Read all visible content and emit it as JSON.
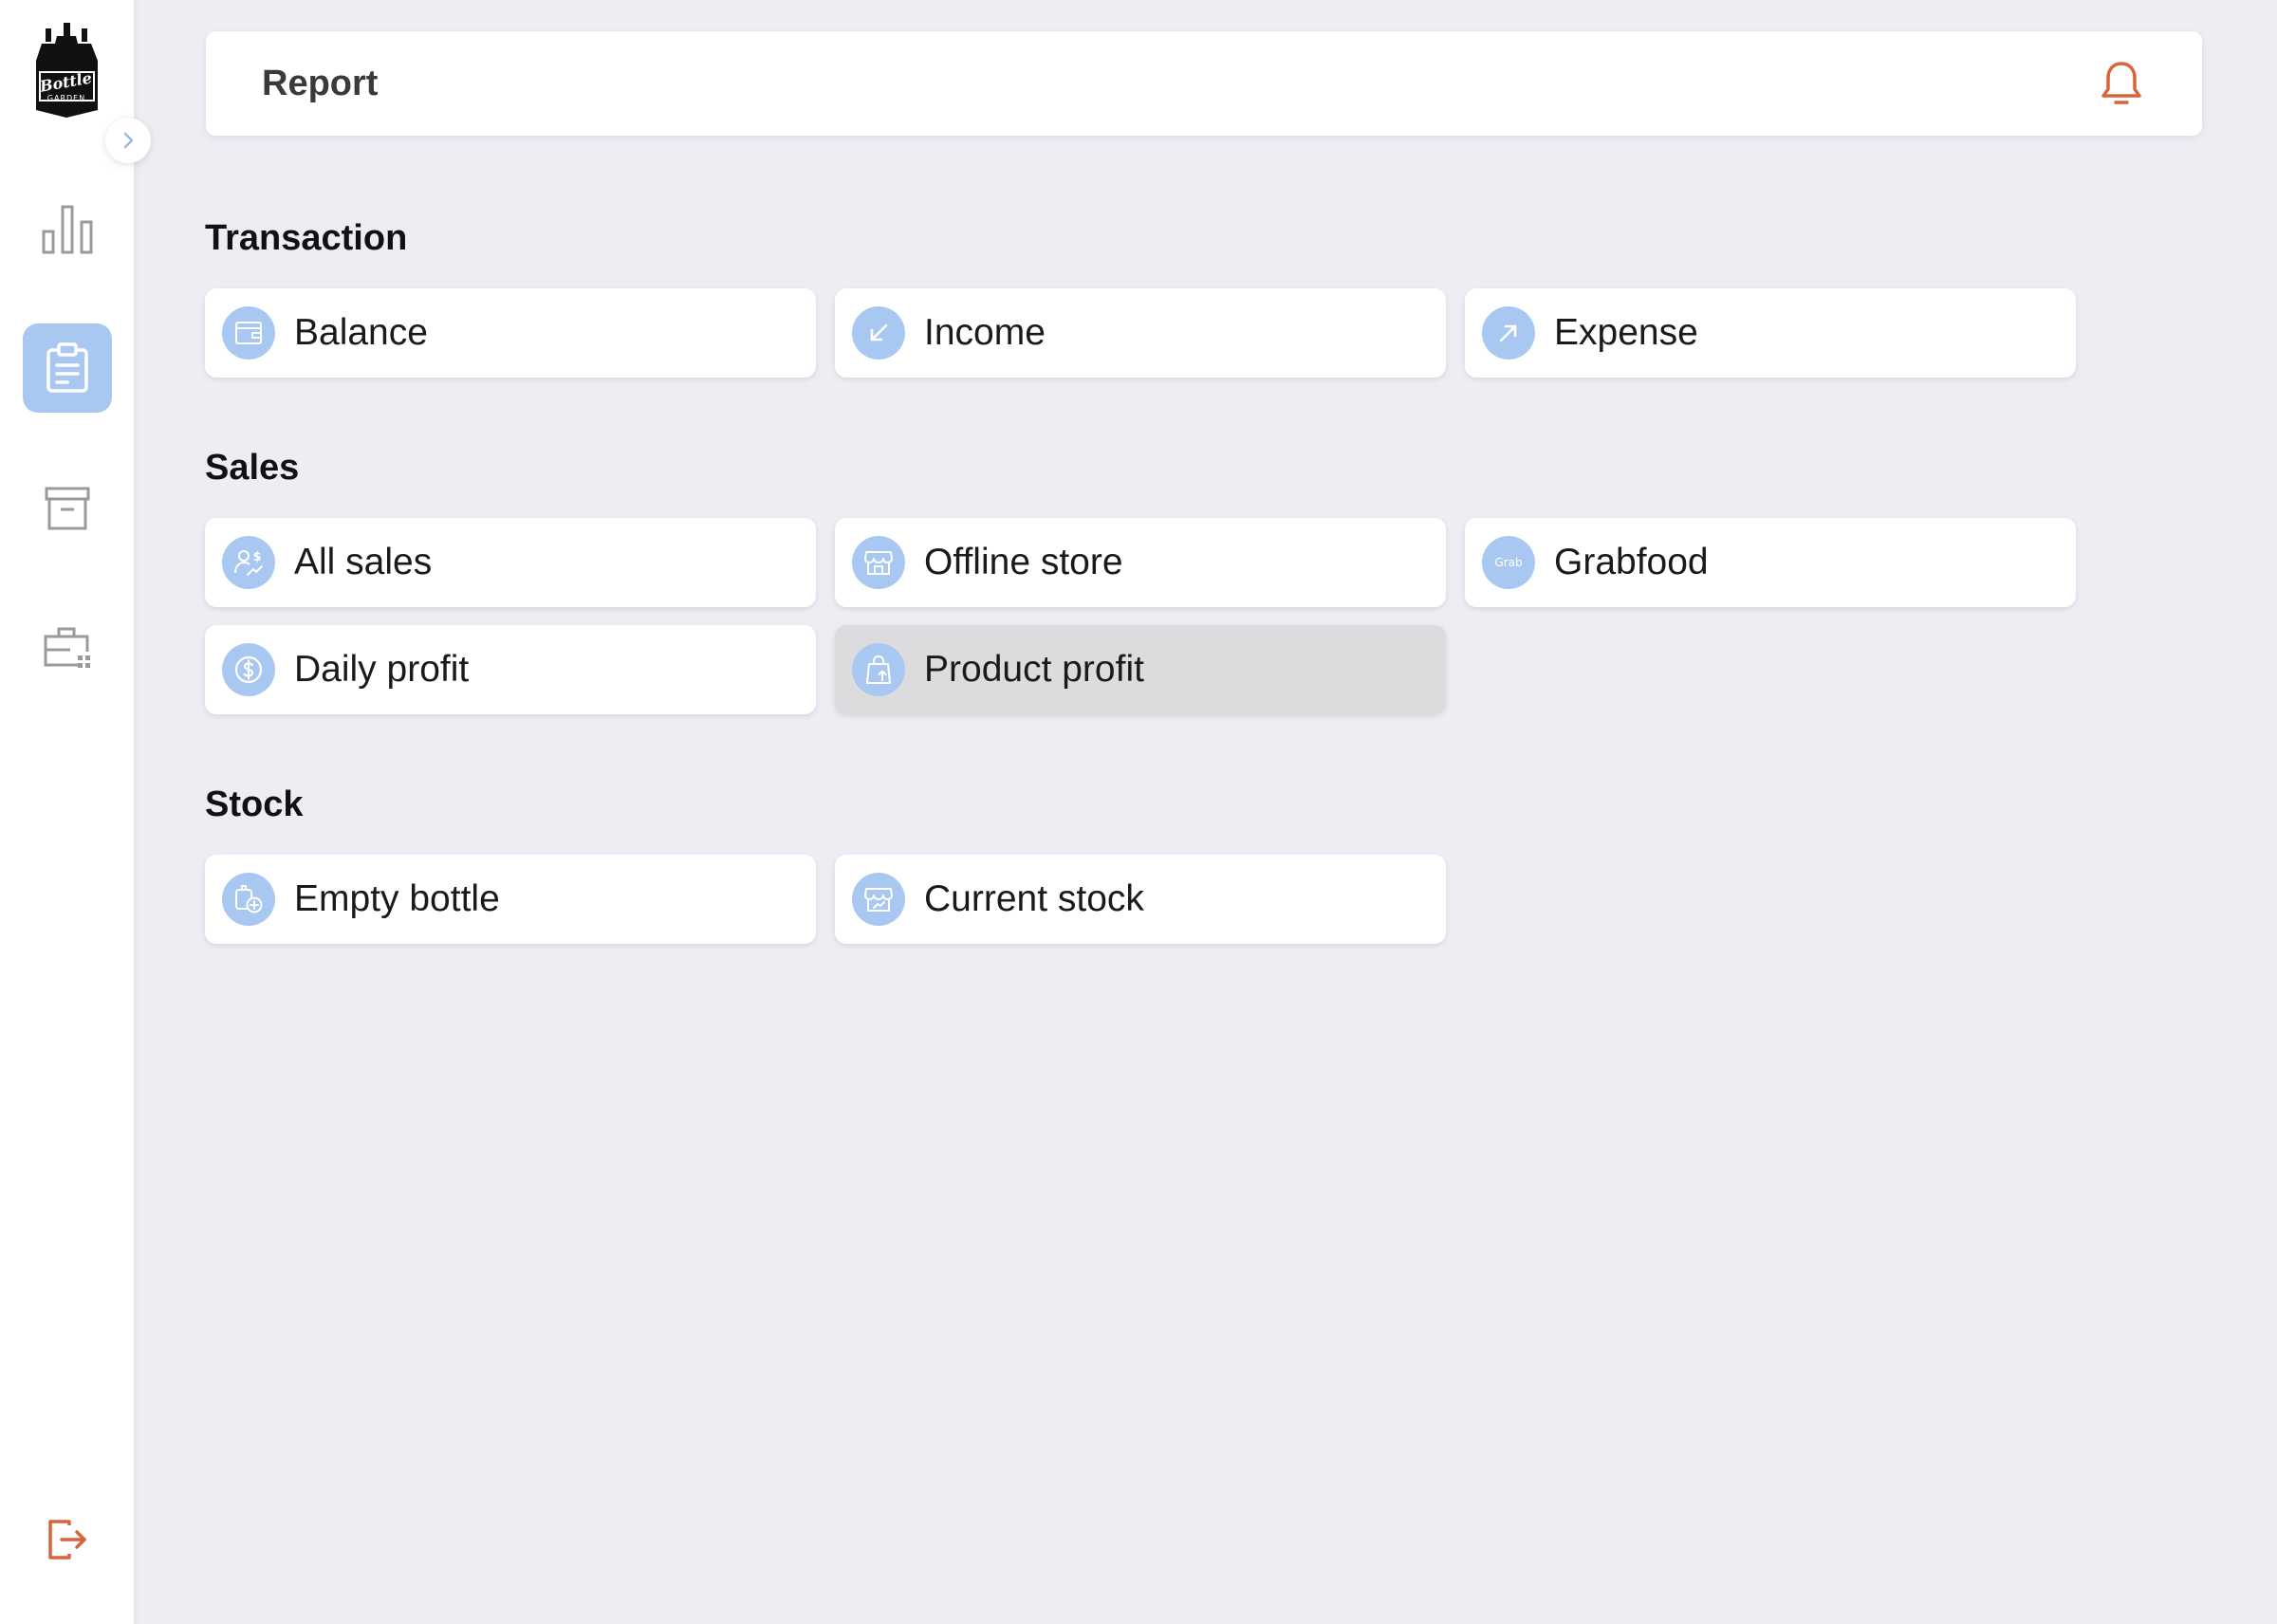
{
  "header": {
    "title": "Report"
  },
  "logo": {
    "line1": "Bottle",
    "line2": "GARDEN"
  },
  "sidebar": {
    "items": [
      {
        "id": "dashboard",
        "icon": "bar-chart-icon",
        "active": false
      },
      {
        "id": "report",
        "icon": "clipboard-icon",
        "active": true
      },
      {
        "id": "archive",
        "icon": "archive-icon",
        "active": false
      },
      {
        "id": "business",
        "icon": "briefcase-icon",
        "active": false
      }
    ],
    "logout_icon": "logout-icon"
  },
  "sections": {
    "transaction": {
      "title": "Transaction",
      "items": [
        {
          "label": "Balance",
          "icon": "wallet-icon"
        },
        {
          "label": "Income",
          "icon": "arrow-down-left-icon"
        },
        {
          "label": "Expense",
          "icon": "arrow-up-right-icon"
        }
      ]
    },
    "sales": {
      "title": "Sales",
      "items": [
        {
          "label": "All sales",
          "icon": "users-dollar-icon"
        },
        {
          "label": "Offline store",
          "icon": "store-icon"
        },
        {
          "label": "Grabfood",
          "icon": "grab-icon",
          "icon_text": "Grab"
        },
        {
          "label": "Daily profit",
          "icon": "dollar-circle-icon"
        },
        {
          "label": "Product profit",
          "icon": "shopping-bag-up-icon"
        }
      ]
    },
    "stock": {
      "title": "Stock",
      "items": [
        {
          "label": "Empty bottle",
          "icon": "bottle-add-icon"
        },
        {
          "label": "Current stock",
          "icon": "stock-store-icon"
        }
      ]
    }
  },
  "colors": {
    "accent": "#a9c8f1",
    "background": "#ededf4",
    "alert": "#d9643a",
    "hover_card": "#dcdcdf"
  }
}
